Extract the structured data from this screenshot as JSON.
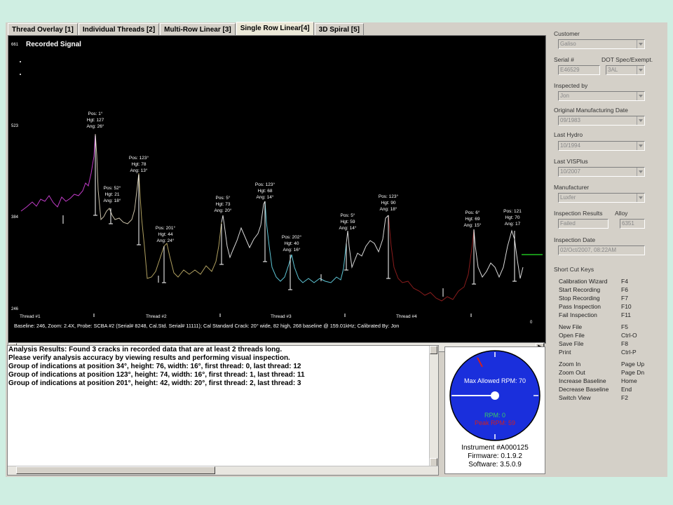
{
  "tabs": [
    "Thread Overlay [1]",
    "Individual Threads [2]",
    "Multi-Row Linear [3]",
    "Single Row Linear[4]",
    "3D Spiral [5]"
  ],
  "plot": {
    "title": "Recorded Signal",
    "y_ticks": [
      "661",
      "523",
      "384",
      "246"
    ],
    "right_value": "0",
    "threads": [
      "Thread #1",
      "Thread #2",
      "Thread #3",
      "Thread #4"
    ],
    "status": "Baseline: 246, Zoom: 2.4X, Probe: SCBA #2 (Serial# 8248, Cal.Std. Serial# 11111); Cal Standard Crack: 20° wide, 82 high, 268 baseline @ 159.01kHz; Calibrated By: Jon",
    "peaks": [
      {
        "l1": "Pos: 1°",
        "l2": "Hgt: 127",
        "l3": "Ang: 26°"
      },
      {
        "l1": "Pos: 52°",
        "l2": "Hgt: 21",
        "l3": "Ang: 18°"
      },
      {
        "l1": "Pos: 123°",
        "l2": "Hgt: 78",
        "l3": "Ang: 13°"
      },
      {
        "l1": "Pos: 201°",
        "l2": "Hgt: 44",
        "l3": "Ang: 24°"
      },
      {
        "l1": "Pos: 5°",
        "l2": "Hgt: 73",
        "l3": "Ang: 20°"
      },
      {
        "l1": "Pos: 123°",
        "l2": "Hgt: 68",
        "l3": "Ang: 14°"
      },
      {
        "l1": "Pos: 202°",
        "l2": "Hgt: 40",
        "l3": "Ang: 16°"
      },
      {
        "l1": "Pos: 5°",
        "l2": "Hgt: 59",
        "l3": "Ang: 14°"
      },
      {
        "l1": "Pos: 123°",
        "l2": "Hgt: 90",
        "l3": "Ang: 18°"
      },
      {
        "l1": "Pos: 6°",
        "l2": "Hgt: 69",
        "l3": "Ang: 15°"
      },
      {
        "l1": "Pos: 121",
        "l2": "Hgt: 70",
        "l3": "Ang: 17"
      }
    ]
  },
  "results": [
    "Analysis Results: Found 3 cracks in recorded data that are at least 2 threads long.",
    "Please verify analysis accuracy by viewing results and performing visual inspection.",
    "Group of indications at position 34°, height: 76, width: 16°, first thread: 0, last thread: 12",
    "Group of indications at position 123°, height: 74, width: 16°, first thread: 1, last thread: 11",
    "Group of indications at position 201°, height: 42, width: 20°, first thread: 2, last thread: 3"
  ],
  "gauge": {
    "max_label": "Max Allowed RPM: 70",
    "rpm_label": "RPM: 0",
    "peak_label": "Peak RPM: 59",
    "instrument": "Instrument #A000125",
    "firmware": "Firmware: 0.1.9.2",
    "software": "Software: 3.5.0.9"
  },
  "form": {
    "customer_label": "Customer",
    "customer": "Galiso",
    "serial_label": "Serial #",
    "serial": "E46529",
    "dot_label": "DOT Spec/Exempt.",
    "dot": "3AL",
    "inspected_by_label": "Inspected by",
    "inspected_by": "Jon",
    "orig_date_label": "Original Manufacturing Date",
    "orig_date": "09/1983",
    "last_hydro_label": "Last Hydro",
    "last_hydro": "10/1994",
    "last_visplus_label": "Last VISPlus",
    "last_visplus": "10/2007",
    "manufacturer_label": "Manufacturer",
    "manufacturer": "Luxfer",
    "results_label": "Inspection Results",
    "results": "Failed",
    "alloy_label": "Alloy",
    "alloy": "6351",
    "insp_date_label": "Inspection Date",
    "insp_date": "02/Oct/2007, 08:22AM"
  },
  "shortcuts": {
    "title": "Short Cut Keys",
    "items": [
      {
        "name": "Calibration Wizard",
        "key": "F4"
      },
      {
        "name": "Start Recording",
        "key": "F6"
      },
      {
        "name": "Stop Recording",
        "key": "F7"
      },
      {
        "name": "Pass Inspection",
        "key": "F10"
      },
      {
        "name": "Fail Inspection",
        "key": "F11"
      },
      {
        "name": "New File",
        "key": "F5"
      },
      {
        "name": "Open File",
        "key": "Ctrl-O"
      },
      {
        "name": "Save File",
        "key": "F8"
      },
      {
        "name": "Print",
        "key": "Ctrl-P"
      },
      {
        "name": "Zoom In",
        "key": "Page Up"
      },
      {
        "name": "Zoom Out",
        "key": "Page Dn"
      },
      {
        "name": "Increase Baseline",
        "key": "Home"
      },
      {
        "name": "Decrease Baseline",
        "key": "End"
      },
      {
        "name": "Switch View",
        "key": "F2"
      }
    ]
  }
}
